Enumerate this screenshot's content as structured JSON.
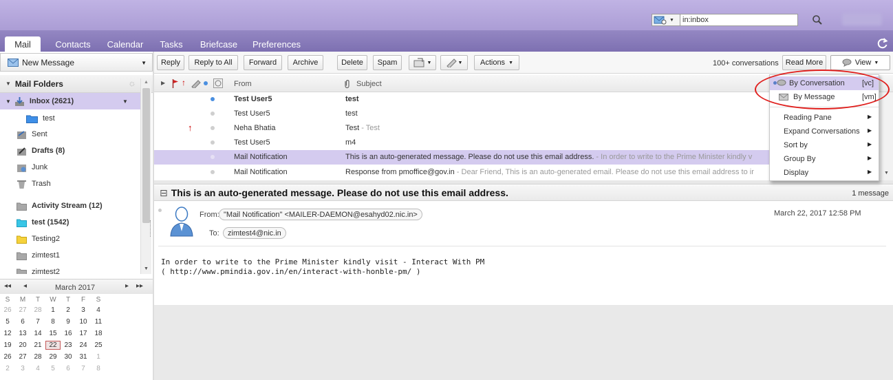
{
  "search": {
    "value": "in:inbox",
    "type_icon": "mail-search-type-icon"
  },
  "tabs": [
    {
      "label": "Mail",
      "active": true
    },
    {
      "label": "Contacts"
    },
    {
      "label": "Calendar"
    },
    {
      "label": "Tasks"
    },
    {
      "label": "Briefcase"
    },
    {
      "label": "Preferences"
    }
  ],
  "left": {
    "new_message": "New Message",
    "folders_title": "Mail Folders",
    "folders": [
      {
        "label": "Inbox (2621)",
        "icon": "inbox-icon",
        "bold": true,
        "selected": true
      },
      {
        "label": "test",
        "icon": "folder-blue-icon"
      },
      {
        "label": "Sent",
        "icon": "sent-icon"
      },
      {
        "label": "Drafts (8)",
        "icon": "drafts-icon",
        "bold": true
      },
      {
        "label": "Junk",
        "icon": "junk-icon"
      },
      {
        "label": "Trash",
        "icon": "trash-icon"
      },
      {
        "label": "Activity Stream (12)",
        "icon": "folder-gray-icon",
        "bold": true
      },
      {
        "label": "test (1542)",
        "icon": "folder-cyan-icon",
        "bold": true
      },
      {
        "label": "Testing2",
        "icon": "folder-yellow-icon"
      },
      {
        "label": "zimtest1",
        "icon": "folder-gray-icon"
      },
      {
        "label": "zimtest2",
        "icon": "folder-gray-icon"
      }
    ]
  },
  "calendar": {
    "title": "March 2017",
    "weekdays": [
      "S",
      "M",
      "T",
      "W",
      "T",
      "F",
      "S"
    ],
    "weeks": [
      [
        "26",
        "27",
        "28",
        "1",
        "2",
        "3",
        "4"
      ],
      [
        "5",
        "6",
        "7",
        "8",
        "9",
        "10",
        "11"
      ],
      [
        "12",
        "13",
        "14",
        "15",
        "16",
        "17",
        "18"
      ],
      [
        "19",
        "20",
        "21",
        "22",
        "23",
        "24",
        "25"
      ],
      [
        "26",
        "27",
        "28",
        "29",
        "30",
        "31",
        "1"
      ],
      [
        "2",
        "3",
        "4",
        "5",
        "6",
        "7",
        "8"
      ]
    ],
    "today": "22"
  },
  "toolbar": {
    "reply": "Reply",
    "reply_all": "Reply to All",
    "forward": "Forward",
    "archive": "Archive",
    "delete": "Delete",
    "spam": "Spam",
    "actions": "Actions",
    "conversation_count": "100+ conversations",
    "read_more": "Read More",
    "view": "View"
  },
  "list": {
    "col_from": "From",
    "col_subject": "Subject",
    "rows": [
      {
        "from": "Test User5",
        "subject": "test",
        "fragment": "",
        "unread": true
      },
      {
        "from": "Test User5",
        "subject": "test",
        "fragment": ""
      },
      {
        "from": "Neha Bhatia",
        "subject": "Test",
        "fragment": " - Test",
        "priority": true
      },
      {
        "from": "Test User5",
        "subject": "m4",
        "fragment": ""
      },
      {
        "from": "Mail Notification",
        "subject": "This is an auto-generated message. Please do not use this email address.",
        "fragment": " - In order to write to the Prime Minister kindly v",
        "selected": true
      },
      {
        "from": "Mail Notification",
        "subject": "Response from pmoffice@gov.in",
        "fragment": " - Dear Friend, This is an auto-generated email. Please do not use this email address to ir"
      }
    ]
  },
  "reading": {
    "title": "This is an auto-generated message. Please do not use this email address.",
    "message_count": "1 message",
    "from_label": "From:",
    "from_value": "\"Mail Notification\" <MAILER-DAEMON@esahyd02.nic.in>",
    "to_label": "To:",
    "to_value": "zimtest4@nic.in",
    "date": "March 22, 2017 12:58 PM",
    "body_line1": "In order to write to the Prime Minister kindly visit - Interact With PM",
    "body_line2": "( http://www.pmindia.gov.in/en/interact-with-honble-pm/ )"
  },
  "view_menu": {
    "by_conversation": "By Conversation",
    "by_conversation_key": "[vc]",
    "by_message": "By Message",
    "by_message_key": "[vm]",
    "items": [
      "Reading Pane",
      "Expand Conversations",
      "Sort by",
      "Group By",
      "Display"
    ]
  }
}
